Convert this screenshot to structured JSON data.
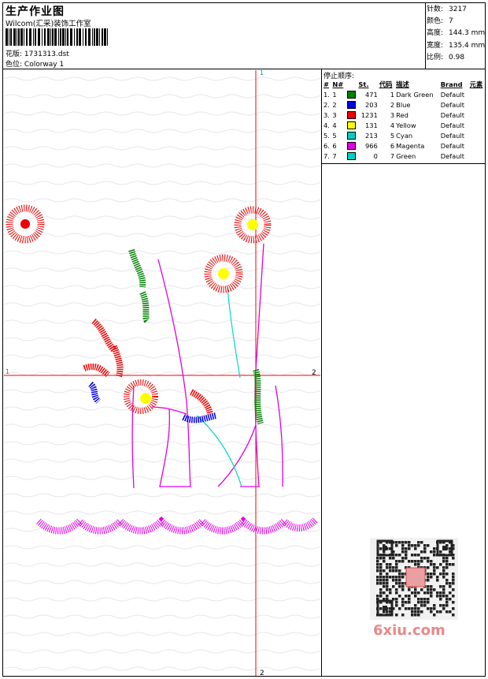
{
  "header": {
    "title": "生产作业图",
    "company": "Wilcom(汇采)装饰工作室",
    "pattern_label": "花版: ",
    "pattern_value": "1731313.dst",
    "colorway_label": "色位: ",
    "colorway_value": "Colorway 1"
  },
  "stats": [
    {
      "label": "针数:",
      "value": "3217"
    },
    {
      "label": "颜色:",
      "value": "7"
    },
    {
      "label": "高度:",
      "value": "144.3 mm"
    },
    {
      "label": "宽度:",
      "value": "135.4 mm"
    },
    {
      "label": "比例:",
      "value": "0.98"
    }
  ],
  "stop_sequence": {
    "title": "停止顺序:",
    "headers": [
      "#",
      "N#",
      "St.",
      "代码",
      "描述",
      "Brand",
      "元素"
    ],
    "rows": [
      {
        "num": "1.",
        "n": "1",
        "st": "471",
        "code": "1",
        "desc": "Dark Green",
        "brand": "Default",
        "color": "#008000"
      },
      {
        "num": "2.",
        "n": "2",
        "st": "203",
        "code": "2",
        "desc": "Blue",
        "brand": "Default",
        "color": "#0000e0"
      },
      {
        "num": "3.",
        "n": "3",
        "st": "1231",
        "code": "3",
        "desc": "Red",
        "brand": "Default",
        "color": "#ee0000"
      },
      {
        "num": "4.",
        "n": "4",
        "st": "131",
        "code": "4",
        "desc": "Yellow",
        "brand": "Default",
        "color": "#ffff00"
      },
      {
        "num": "5.",
        "n": "5",
        "st": "213",
        "code": "5",
        "desc": "Cyan",
        "brand": "Default",
        "color": "#00d0c0"
      },
      {
        "num": "6.",
        "n": "6",
        "st": "966",
        "code": "6",
        "desc": "Magenta",
        "brand": "Default",
        "color": "#e000e0"
      },
      {
        "num": "7.",
        "n": "7",
        "st": "0",
        "code": "7",
        "desc": "Green",
        "brand": "Default",
        "color": "#00d0c0"
      }
    ]
  },
  "axis_labels": {
    "top": "1",
    "bottom": "2",
    "left": "1",
    "right": "2"
  },
  "watermark": "6xiu.com"
}
